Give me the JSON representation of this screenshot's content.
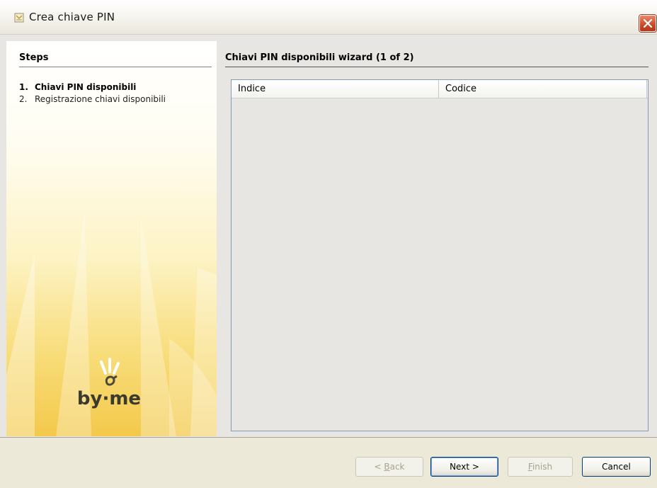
{
  "window": {
    "title": "Crea chiave PIN",
    "close_icon": "close-icon"
  },
  "steps": {
    "heading": "Steps",
    "items": [
      {
        "num": "1.",
        "label": "Chiavi PIN disponibili",
        "active": true
      },
      {
        "num": "2.",
        "label": "Registrazione chiavi disponibili",
        "active": false
      }
    ],
    "logo_text": "by-me"
  },
  "main": {
    "title": "Chiavi PIN disponibili wizard (1 of 2)",
    "table": {
      "columns": [
        "Indice",
        "Codice"
      ],
      "rows": []
    }
  },
  "buttons": {
    "back": {
      "prefix": "< ",
      "mnemonic": "B",
      "rest": "ack",
      "enabled": false
    },
    "next": {
      "label": "Next >",
      "enabled": true
    },
    "finish": {
      "mnemonic": "F",
      "rest": "inish",
      "enabled": false
    },
    "cancel": {
      "label": "Cancel",
      "enabled": true
    }
  },
  "colors": {
    "accent_close": "#c94a2a",
    "panel_yellow": "#f3c94b",
    "table_border": "#7f9db9"
  }
}
